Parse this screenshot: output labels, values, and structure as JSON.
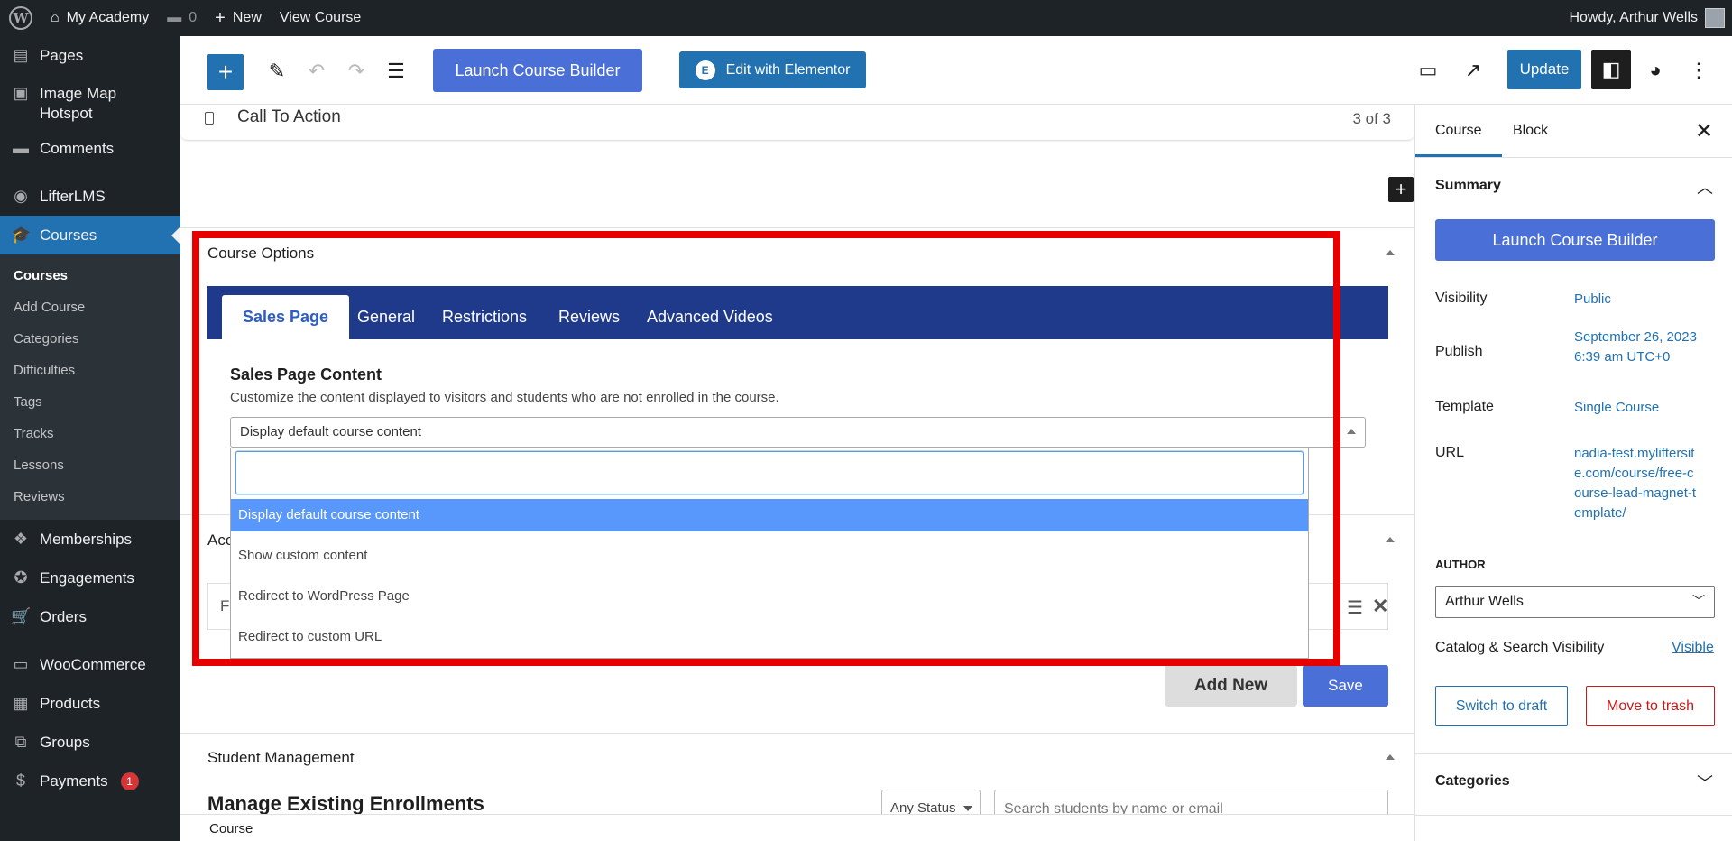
{
  "admin_bar": {
    "site_name": "My Academy",
    "comments_count": "0",
    "new_label": "New",
    "view_label": "View Course",
    "greeting": "Howdy, Arthur Wells"
  },
  "sidebar": {
    "items_top": [
      {
        "label": "Pages",
        "icon": "pages-icon",
        "glyph": "▤"
      },
      {
        "label": "Image Map Hotspot",
        "icon": "image-icon",
        "glyph": "▣"
      },
      {
        "label": "Comments",
        "icon": "comments-icon",
        "glyph": "▬"
      },
      {
        "label": "LifterLMS",
        "icon": "lifterlms-icon",
        "glyph": "◉"
      },
      {
        "label": "Courses",
        "icon": "courses-icon",
        "glyph": "🎓"
      }
    ],
    "submenu": [
      "Courses",
      "Add Course",
      "Categories",
      "Difficulties",
      "Tags",
      "Tracks",
      "Lessons",
      "Reviews"
    ],
    "items_bottom": [
      {
        "label": "Memberships",
        "icon": "memberships-icon",
        "glyph": "❖"
      },
      {
        "label": "Engagements",
        "icon": "engagements-icon",
        "glyph": "✪"
      },
      {
        "label": "Orders",
        "icon": "orders-icon",
        "glyph": "🛒"
      },
      {
        "label": "WooCommerce",
        "icon": "woocommerce-icon",
        "glyph": "▭"
      },
      {
        "label": "Products",
        "icon": "products-icon",
        "glyph": "▦"
      },
      {
        "label": "Groups",
        "icon": "groups-icon",
        "glyph": "⧉"
      },
      {
        "label": "Payments",
        "icon": "payments-icon",
        "glyph": "$",
        "badge": "1"
      }
    ]
  },
  "toolbar": {
    "launch_builder": "Launch Course Builder",
    "edit_elementor": "Edit with Elementor",
    "update": "Update"
  },
  "main": {
    "cta_block_label": "Call To Action",
    "cta_block_count": "3 of 3",
    "course_options_title": "Course Options",
    "tabs": [
      "Sales Page",
      "General",
      "Restrictions",
      "Reviews",
      "Advanced Videos"
    ],
    "active_tab": "Sales Page",
    "sales_page": {
      "title": "Sales Page Content",
      "description": "Customize the content displayed to visitors and students who are not enrolled in the course.",
      "selected": "Display default course content",
      "search_value": "",
      "options": [
        "Display default course content",
        "Show custom content",
        "Redirect to WordPress Page",
        "Redirect to custom URL"
      ]
    },
    "access_title_partial": "Acc",
    "access_row_partial": "F",
    "add_new": "Add New",
    "save": "Save",
    "student_management_title": "Student Management",
    "manage_enrollments": "Manage Existing Enrollments",
    "status_filter": "Any Status",
    "student_search_placeholder": "Search students by name or email"
  },
  "footer": {
    "breadcrumb": "Course"
  },
  "settings": {
    "tabs": [
      "Course",
      "Block"
    ],
    "summary_title": "Summary",
    "launch_builder": "Launch Course Builder",
    "visibility_label": "Visibility",
    "visibility_value": "Public",
    "publish_label": "Publish",
    "publish_value": "September 26, 2023 6:39 am UTC+0",
    "template_label": "Template",
    "template_value": "Single Course",
    "url_label": "URL",
    "url_value": "nadia-test.mylifter­site.com/course/free-course-lead-magnet-template/",
    "author_label": "AUTHOR",
    "author_value": "Arthur Wells",
    "catalog_label": "Catalog & Search Visibility",
    "catalog_value": "Visible",
    "switch_draft": "Switch to draft",
    "move_trash": "Move to trash",
    "categories_title": "Categories"
  },
  "colors": {
    "admin_dark": "#1d2327",
    "wp_blue": "#2271b1",
    "lifter_blue": "#4a6fd6",
    "tabs_navy": "#1f3a8a",
    "highlight_frame": "#e60000",
    "select2_highlight": "#5897fb"
  }
}
